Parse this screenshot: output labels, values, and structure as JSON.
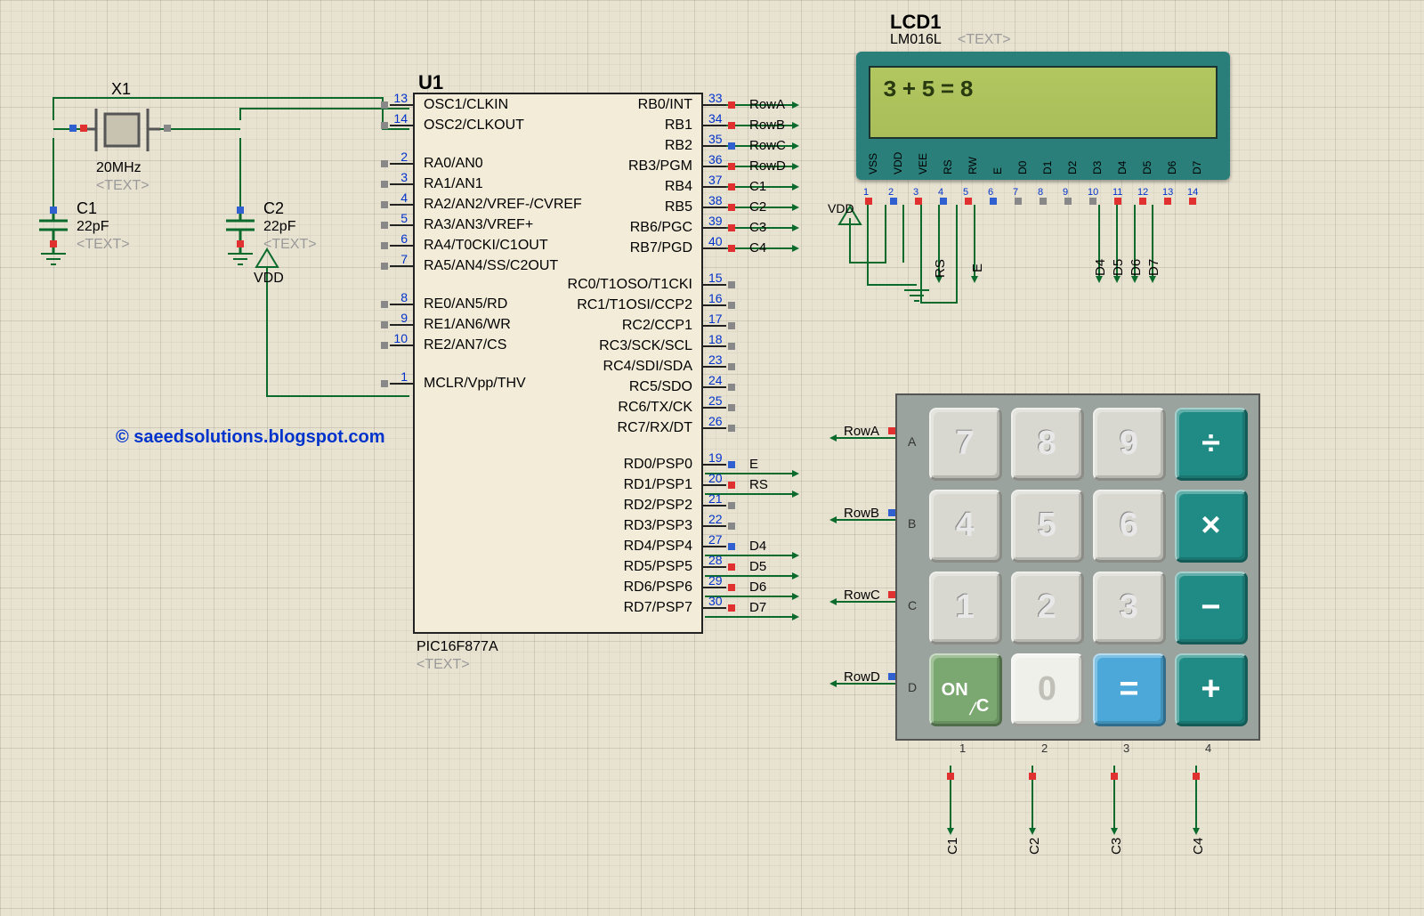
{
  "credit": "© saeedsolutions.blogspot.com",
  "components": {
    "crystal": {
      "ref": "X1",
      "value": "20MHz",
      "placeholder": "<TEXT>"
    },
    "c1": {
      "ref": "C1",
      "value": "22pF",
      "placeholder": "<TEXT>"
    },
    "c2": {
      "ref": "C2",
      "value": "22pF",
      "placeholder": "<TEXT>"
    },
    "vdd": "VDD",
    "u1": {
      "ref": "U1",
      "part": "PIC16F877A",
      "placeholder": "<TEXT>",
      "left_pins": [
        {
          "num": "13",
          "name": "OSC1/CLKIN"
        },
        {
          "num": "14",
          "name": "OSC2/CLKOUT"
        },
        {
          "spacer": true
        },
        {
          "num": "2",
          "name": "RA0/AN0"
        },
        {
          "num": "3",
          "name": "RA1/AN1"
        },
        {
          "num": "4",
          "name": "RA2/AN2/VREF-/CVREF"
        },
        {
          "num": "5",
          "name": "RA3/AN3/VREF+"
        },
        {
          "num": "6",
          "name": "RA4/T0CKI/C1OUT"
        },
        {
          "num": "7",
          "name": "RA5/AN4/SS/C2OUT"
        },
        {
          "spacer": true
        },
        {
          "num": "8",
          "name": "RE0/AN5/RD"
        },
        {
          "num": "9",
          "name": "RE1/AN6/WR"
        },
        {
          "num": "10",
          "name": "RE2/AN7/CS"
        },
        {
          "spacer": true
        },
        {
          "num": "1",
          "name": "MCLR/Vpp/THV"
        }
      ],
      "right_pins": [
        {
          "num": "33",
          "name": "RB0/INT",
          "net": "RowA"
        },
        {
          "num": "34",
          "name": "RB1",
          "net": "RowB"
        },
        {
          "num": "35",
          "name": "RB2",
          "net": "RowC",
          "in": true
        },
        {
          "num": "36",
          "name": "RB3/PGM",
          "net": "RowD"
        },
        {
          "num": "37",
          "name": "RB4",
          "net": "C1"
        },
        {
          "num": "38",
          "name": "RB5",
          "net": "C2"
        },
        {
          "num": "39",
          "name": "RB6/PGC",
          "net": "C3"
        },
        {
          "num": "40",
          "name": "RB7/PGD",
          "net": "C4"
        },
        {
          "spacer": true
        },
        {
          "num": "15",
          "name": "RC0/T1OSO/T1CKI"
        },
        {
          "num": "16",
          "name": "RC1/T1OSI/CCP2"
        },
        {
          "num": "17",
          "name": "RC2/CCP1"
        },
        {
          "num": "18",
          "name": "RC3/SCK/SCL"
        },
        {
          "num": "23",
          "name": "RC4/SDI/SDA"
        },
        {
          "num": "24",
          "name": "RC5/SDO"
        },
        {
          "num": "25",
          "name": "RC6/TX/CK"
        },
        {
          "num": "26",
          "name": "RC7/RX/DT"
        },
        {
          "spacer": true
        },
        {
          "num": "19",
          "name": "RD0/PSP0",
          "net": "E",
          "in": true
        },
        {
          "num": "20",
          "name": "RD1/PSP1",
          "net": "RS"
        },
        {
          "num": "21",
          "name": "RD2/PSP2"
        },
        {
          "num": "22",
          "name": "RD3/PSP3"
        },
        {
          "num": "27",
          "name": "RD4/PSP4",
          "net": "D4",
          "in": true
        },
        {
          "num": "28",
          "name": "RD5/PSP5",
          "net": "D5"
        },
        {
          "num": "29",
          "name": "RD6/PSP6",
          "net": "D6"
        },
        {
          "num": "30",
          "name": "RD7/PSP7",
          "net": "D7"
        }
      ]
    },
    "lcd": {
      "ref": "LCD1",
      "part": "LM016L",
      "placeholder": "<TEXT>",
      "display_text": "3+5=8",
      "pins": [
        "VSS",
        "VDD",
        "VEE",
        "RS",
        "RW",
        "E",
        "D0",
        "D1",
        "D2",
        "D3",
        "D4",
        "D5",
        "D6",
        "D7"
      ],
      "pin_nums": [
        "1",
        "2",
        "3",
        "4",
        "5",
        "6",
        "7",
        "8",
        "9",
        "10",
        "11",
        "12",
        "13",
        "14"
      ],
      "nets_below": [
        "RS",
        "E",
        "D4",
        "D5",
        "D6",
        "D7"
      ],
      "vdd_label": "VDD"
    },
    "keypad": {
      "rows": [
        "A",
        "B",
        "C",
        "D"
      ],
      "cols": [
        "1",
        "2",
        "3",
        "4"
      ],
      "row_nets": [
        "RowA",
        "RowB",
        "RowC",
        "RowD"
      ],
      "col_nets": [
        "C1",
        "C2",
        "C3",
        "C4"
      ],
      "keys": [
        [
          "7",
          "8",
          "9",
          "÷"
        ],
        [
          "4",
          "5",
          "6",
          "×"
        ],
        [
          "1",
          "2",
          "3",
          "−"
        ],
        [
          "ON/C",
          "0",
          "=",
          "+"
        ]
      ]
    }
  }
}
